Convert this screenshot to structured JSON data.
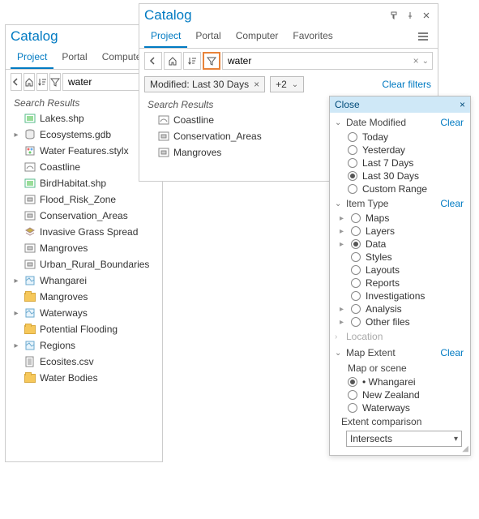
{
  "left_pane": {
    "title": "Catalog",
    "tabs": [
      "Project",
      "Portal",
      "Computer"
    ],
    "active_tab": 0,
    "search_value": "water",
    "search_results_label": "Search Results",
    "items": [
      {
        "icon": "shapefile",
        "label": "Lakes.shp"
      },
      {
        "icon": "geodatabase",
        "label": "Ecosystems.gdb",
        "expandable": true
      },
      {
        "icon": "stylx",
        "label": "Water Features.stylx"
      },
      {
        "icon": "featureclass-line",
        "label": "Coastline"
      },
      {
        "icon": "shapefile",
        "label": "BirdHabitat.shp"
      },
      {
        "icon": "featureclass-poly",
        "label": "Flood_Risk_Zone"
      },
      {
        "icon": "featureclass-poly",
        "label": "Conservation_Areas"
      },
      {
        "icon": "layer",
        "label": "Invasive Grass Spread"
      },
      {
        "icon": "featureclass-poly",
        "label": "Mangroves"
      },
      {
        "icon": "featureclass-poly",
        "label": "Urban_Rural_Boundaries"
      },
      {
        "icon": "map",
        "label": "Whangarei",
        "expandable": true
      },
      {
        "icon": "folder",
        "label": "Mangroves"
      },
      {
        "icon": "map",
        "label": "Waterways",
        "expandable": true
      },
      {
        "icon": "folder",
        "label": "Potential Flooding"
      },
      {
        "icon": "map",
        "label": "Regions",
        "expandable": true
      },
      {
        "icon": "csv",
        "label": "Ecosites.csv"
      },
      {
        "icon": "folder",
        "label": "Water Bodies"
      }
    ]
  },
  "right_pane": {
    "title": "Catalog",
    "tabs": [
      "Project",
      "Portal",
      "Computer",
      "Favorites"
    ],
    "active_tab": 0,
    "search_value": "water",
    "chip_label": "Modified: Last 30 Days",
    "chip_more": "+2",
    "clear_filters": "Clear filters",
    "search_results_label": "Search Results",
    "items": [
      {
        "icon": "featureclass-line",
        "label": "Coastline"
      },
      {
        "icon": "featureclass-poly",
        "label": "Conservation_Areas"
      },
      {
        "icon": "featureclass-poly",
        "label": "Mangroves"
      }
    ]
  },
  "filter_panel": {
    "close_label": "Close",
    "sections": {
      "date_modified": {
        "title": "Date Modified",
        "clear": "Clear",
        "options": [
          "Today",
          "Yesterday",
          "Last 7 Days",
          "Last 30 Days",
          "Custom Range"
        ],
        "selected": 3
      },
      "item_type": {
        "title": "Item Type",
        "clear": "Clear",
        "options": [
          {
            "label": "Maps",
            "expandable": true
          },
          {
            "label": "Layers",
            "expandable": true
          },
          {
            "label": "Data",
            "expandable": true,
            "selected": true
          },
          {
            "label": "Styles"
          },
          {
            "label": "Layouts"
          },
          {
            "label": "Reports"
          },
          {
            "label": "Investigations"
          },
          {
            "label": "Analysis",
            "expandable": true
          },
          {
            "label": "Other files",
            "expandable": true
          }
        ]
      },
      "location": {
        "title": "Location",
        "collapsed": true
      },
      "map_extent": {
        "title": "Map Extent",
        "clear": "Clear",
        "map_or_scene_label": "Map or scene",
        "options": [
          {
            "label": "• Whangarei",
            "selected": true
          },
          {
            "label": "New Zealand"
          },
          {
            "label": "Waterways"
          }
        ],
        "extent_comparison_label": "Extent comparison",
        "extent_comparison_value": "Intersects"
      }
    }
  }
}
